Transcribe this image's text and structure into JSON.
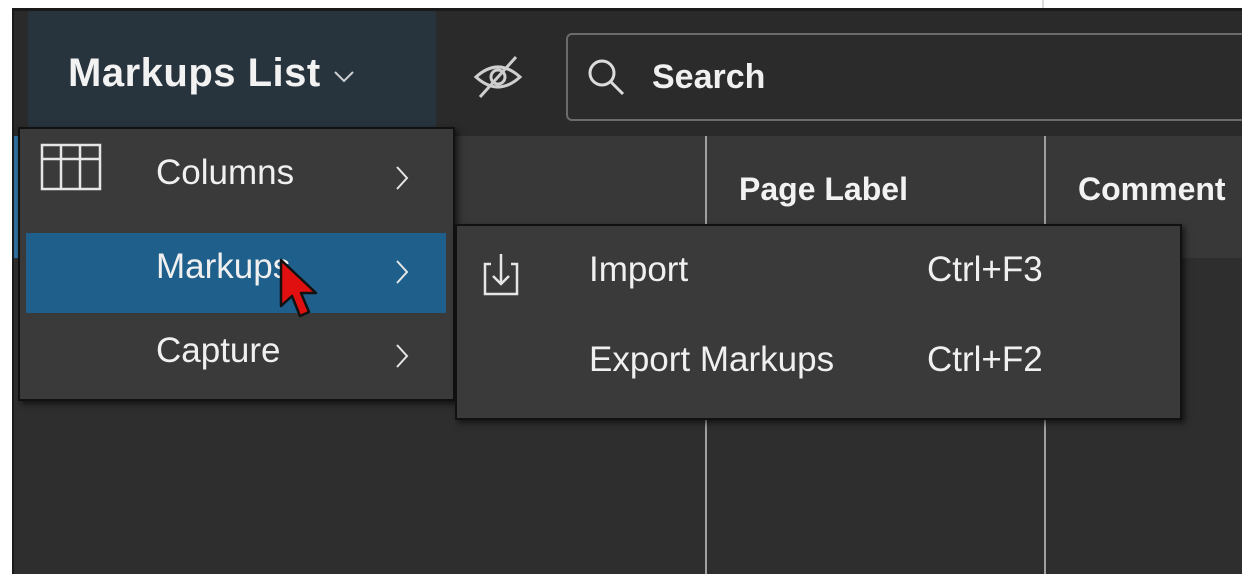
{
  "toolbar": {
    "title": "Markups List",
    "search_placeholder": "Search"
  },
  "columns": {
    "headers": [
      "Page Label",
      "Comment"
    ]
  },
  "context_menu": {
    "items": [
      {
        "label": "Columns",
        "icon": "table-grid-icon"
      },
      {
        "label": "Markups",
        "icon": "",
        "active": true
      },
      {
        "label": "Capture",
        "icon": ""
      }
    ]
  },
  "submenu": {
    "items": [
      {
        "label": "Import",
        "shortcut": "Ctrl+F3",
        "icon": "import-icon"
      },
      {
        "label": "Export Markups",
        "shortcut": "Ctrl+F2",
        "icon": ""
      }
    ]
  },
  "colors": {
    "active_item": "#1f5f8b",
    "panel_bg": "#2e2e2e",
    "menu_bg": "#3a3a3a"
  }
}
